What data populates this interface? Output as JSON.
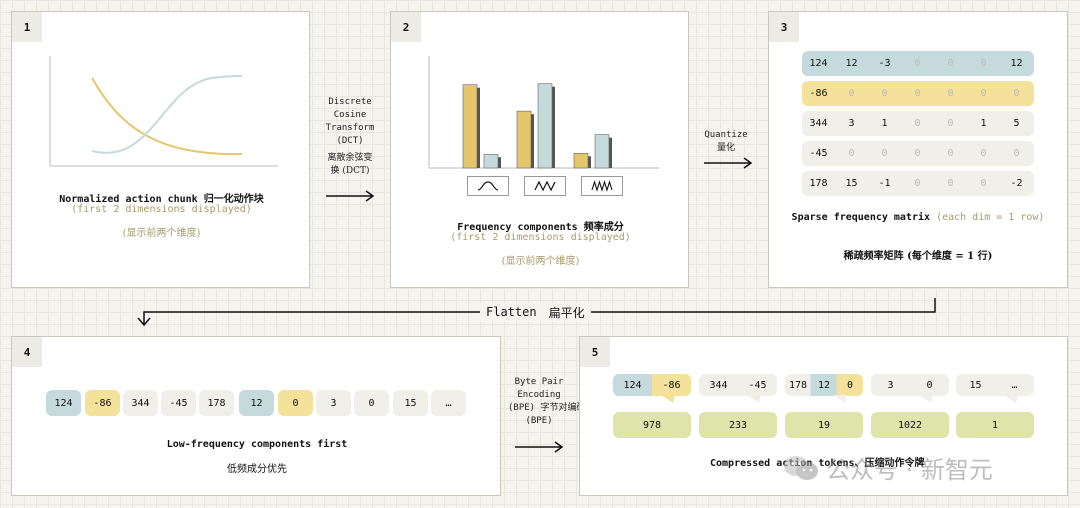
{
  "panel1": {
    "num": "1",
    "title": "Normalized action chunk",
    "title_cn": "归一化动作块",
    "sub": "(first 2 dimensions displayed)",
    "sub_cn": "(显示前两个维度)"
  },
  "arrow1": {
    "lines": [
      "Discrete",
      "Cosine",
      "Transform",
      "(DCT)"
    ],
    "cn": [
      "离散余弦变",
      "换 (DCT)"
    ]
  },
  "panel2": {
    "num": "2",
    "title": "Frequency components",
    "title_cn": "频率成分",
    "sub": "(first 2 dimensions displayed)",
    "sub_cn": "(显示前两个维度)",
    "bars": [
      {
        "yellow": 0.85,
        "blue": 0.14
      },
      {
        "yellow": 0.58,
        "blue": 0.86
      },
      {
        "yellow": 0.15,
        "blue": 0.34
      }
    ]
  },
  "arrow2": {
    "label": "Quantize",
    "cn": "量化"
  },
  "panel3": {
    "num": "3",
    "title": "Sparse frequency matrix",
    "title_note": "(each dim = 1 row)",
    "title_note_2": "row)",
    "title_cn": "稀疏频率矩阵 (每个维度 = 1 行)",
    "rows": [
      {
        "color": "blue",
        "cells": [
          "124",
          "12",
          "-3",
          "0",
          "0",
          "0",
          "12"
        ]
      },
      {
        "color": "yellow",
        "cells": [
          "-86",
          "0",
          "0",
          "0",
          "0",
          "0",
          "0"
        ]
      },
      {
        "color": "grey",
        "cells": [
          "344",
          "3",
          "1",
          "0",
          "0",
          "1",
          "5"
        ]
      },
      {
        "color": "grey",
        "cells": [
          "-45",
          "0",
          "0",
          "0",
          "0",
          "0",
          "0"
        ]
      },
      {
        "color": "grey",
        "cells": [
          "178",
          "15",
          "-1",
          "0",
          "0",
          "0",
          "-2"
        ]
      }
    ]
  },
  "flatten": {
    "label": "Flatten",
    "cn": "扁平化"
  },
  "panel4": {
    "num": "4",
    "title": "Low-frequency components first",
    "title_cn": "低频成分优先",
    "chips": [
      {
        "v": "124",
        "c": "blue"
      },
      {
        "v": "-86",
        "c": "yellow"
      },
      {
        "v": "344",
        "c": "grey"
      },
      {
        "v": "-45",
        "c": "grey"
      },
      {
        "v": "178",
        "c": "grey"
      },
      {
        "v": "12",
        "c": "blue"
      },
      {
        "v": "0",
        "c": "yellow"
      },
      {
        "v": "3",
        "c": "grey"
      },
      {
        "v": "0",
        "c": "grey"
      },
      {
        "v": "15",
        "c": "grey"
      },
      {
        "v": "…",
        "c": "grey"
      }
    ]
  },
  "arrow3": {
    "lines": [
      "Byte Pair",
      "Encoding",
      "(BPE)"
    ],
    "cn": "字节对编码",
    "cn_tail": "(BPE)"
  },
  "panel5": {
    "num": "5",
    "title": "Compressed action tokens",
    "title_cn": "压缩动作令牌",
    "groups": [
      [
        "124",
        "-86"
      ],
      [
        "344",
        "-45"
      ],
      [
        "178",
        "12",
        "0"
      ],
      [
        "3",
        "0"
      ],
      [
        "15",
        "…"
      ]
    ],
    "tokens": [
      "978",
      "233",
      "19",
      "1022",
      "1"
    ]
  },
  "watermark": "公众号 · 新智元",
  "colors": {
    "blue": "#c5dadc",
    "yellow": "#e6c66a",
    "grey": "#f0efea",
    "token_green": "#dfe4ab"
  }
}
